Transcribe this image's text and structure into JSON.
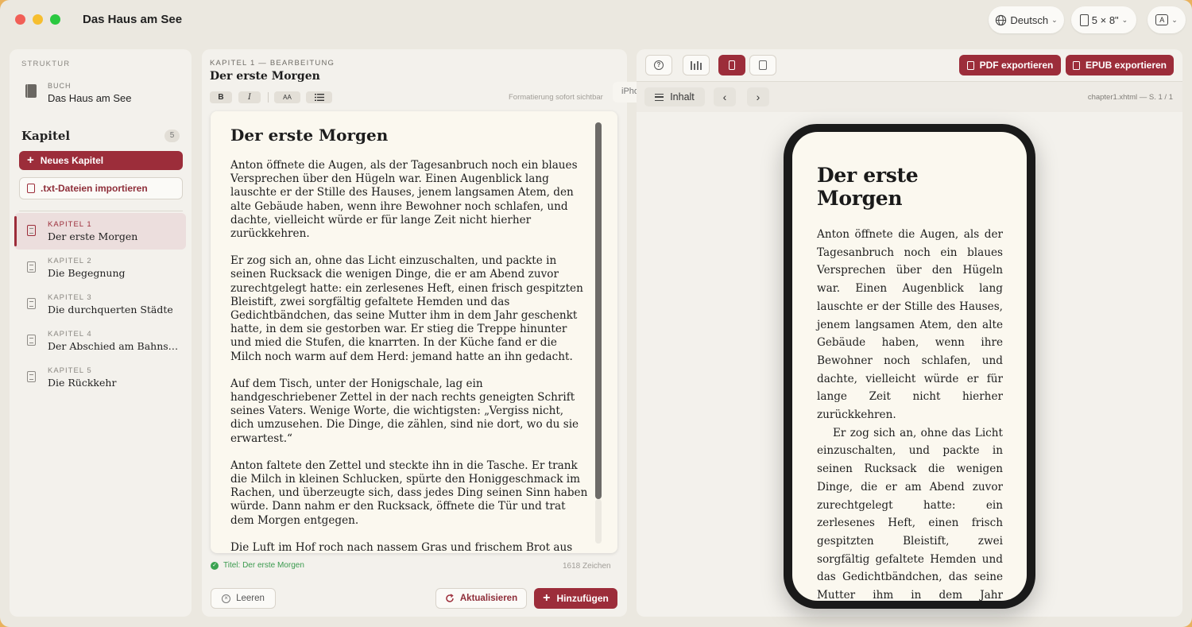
{
  "window": {
    "title": "Das Haus am See"
  },
  "toolbar": {
    "language": "Deutsch",
    "page_size": "5 × 8\""
  },
  "sidebar": {
    "section_label": "STRUKTUR",
    "book_caption": "BUCH",
    "book_name": "Das Haus am See",
    "chapters_title": "Kapitel",
    "chapters_count": "5",
    "new_chapter_label": "Neues Kapitel",
    "import_label": ".txt-Dateien importieren",
    "chapters": [
      {
        "number": "KAPITEL 1",
        "title": "Der erste Morgen",
        "active": true
      },
      {
        "number": "KAPITEL 2",
        "title": "Die Begegnung"
      },
      {
        "number": "KAPITEL 3",
        "title": "Die durchquerten Städte"
      },
      {
        "number": "KAPITEL 4",
        "title": "Der Abschied am Bahnst…"
      },
      {
        "number": "KAPITEL 5",
        "title": "Die Rückkehr"
      }
    ]
  },
  "editor": {
    "caption": "KAPITEL 1 — BEARBEITUNG",
    "title": "Der erste Morgen",
    "format_bold": "B",
    "format_italic": "I",
    "format_size": "AA",
    "format_hint": "Formatierung sofort sichtbar",
    "heading": "Der erste Morgen",
    "paragraphs": [
      "Anton öffnete die Augen, als der Tagesanbruch noch ein blaues Versprechen über den Hügeln war. Einen Augenblick lang lauschte er der Stille des Hauses, jenem langsamen Atem, den alte Gebäude haben, wenn ihre Bewohner noch schlafen, und dachte, vielleicht würde er für lange Zeit nicht hierher zurückkehren.",
      "Er zog sich an, ohne das Licht einzuschalten, und packte in seinen Rucksack die wenigen Dinge, die er am Abend zuvor zurechtgelegt hatte: ein zerlesenes Heft, einen frisch gespitzten Bleistift, zwei sorgfältig gefaltete Hemden und das Gedichtbändchen, das seine Mutter ihm in dem Jahr geschenkt hatte, in dem sie gestorben war. Er stieg die Treppe hinunter und mied die Stufen, die knarrten. In der Küche fand er die Milch noch warm auf dem Herd: jemand hatte an ihn gedacht.",
      "Auf dem Tisch, unter der Honigschale, lag ein handgeschriebener Zettel in der nach rechts geneigten Schrift seines Vaters. Wenige Worte, die wichtigsten: „Vergiss nicht, dich umzusehen. Die Dinge, die zählen, sind nie dort, wo du sie erwartest.“",
      "Anton faltete den Zettel und steckte ihn in die Tasche. Er trank die Milch in kleinen Schlucken, spürte den Honiggeschmack im Rachen, und überzeugte sich, dass jedes Ding seinen Sinn haben würde. Dann nahm er den Rucksack, öffnete die Tür und trat dem Morgen entgegen.",
      "Die Luft im Hof roch nach nassem Gras und frischem Brot aus der Bäckerei am Ende der Straße. Die Fenster des Dorfes waren noch"
    ],
    "status": "Titel: Der erste Morgen",
    "char_count": "1618 Zeichen",
    "clear_label": "Leeren",
    "refresh_label": "Aktualisieren",
    "add_label": "Hinzufügen"
  },
  "preview": {
    "pdf_label": "PDF exportieren",
    "epub_label": "EPUB exportieren",
    "inhalt_label": "Inhalt",
    "location": "chapter1.xhtml — S. 1 / 1",
    "device_tab": "iPhone",
    "heading": "Der erste Morgen",
    "para1": "Anton öffnete die Augen, als der Tagesanbruch noch ein blaues Versprechen über den Hügeln war. Einen Augenblick lang lauschte er der Stille des Hauses, jenem langsamen Atem, den alte Gebäude haben, wenn ihre Bewohner noch schlafen, und dachte, vielleicht würde er für lange Zeit nicht hierher zurückkehren.",
    "para2": "Er zog sich an, ohne das Licht einzuschalten, und packte in seinen Rucksack die wenigen Dinge, die er am Abend zuvor zurechtgelegt hatte: ein zerlesenes Heft, einen frisch gespitzten Bleistift, zwei sorgfältig gefaltete Hemden und das Gedichtbändchen, das seine Mutter ihm in dem Jahr geschenkt hatte, in dem sie gestorben war. Er"
  },
  "icons": {
    "globe": "globe-icon",
    "page": "page-size-icon",
    "accessibility": "text-format-icon",
    "book": "book-icon",
    "chapter": "document-icon",
    "plus": "plus-icon",
    "import": "file-import-icon",
    "help": "help-icon",
    "desktop": "library-icon",
    "phone": "phone-icon",
    "tablet": "tablet-icon",
    "list": "list-icon",
    "prev": "chevron-left-icon",
    "next": "chevron-right-icon",
    "check": "check-circle-icon",
    "clear": "x-circle-icon",
    "refresh": "refresh-icon"
  },
  "colors": {
    "accent": "#9c2d3a",
    "success": "#3aa350",
    "paper": "#fbf8ef"
  }
}
